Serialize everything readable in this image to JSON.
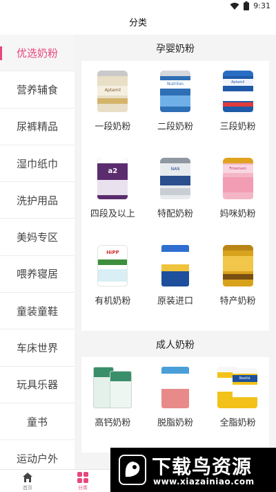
{
  "status_bar": {
    "time": "9:31"
  },
  "header": {
    "title": "分类"
  },
  "sidebar": {
    "items": [
      {
        "label": "优选奶粉",
        "active": true
      },
      {
        "label": "营养辅食"
      },
      {
        "label": "尿裤精品"
      },
      {
        "label": "湿巾纸巾"
      },
      {
        "label": "洗护用品"
      },
      {
        "label": "美妈专区"
      },
      {
        "label": "喂养寝居"
      },
      {
        "label": "童装童鞋"
      },
      {
        "label": "车床世界"
      },
      {
        "label": "玩具乐器"
      },
      {
        "label": "童书"
      },
      {
        "label": "运动户外"
      }
    ]
  },
  "sections": [
    {
      "title": "孕婴奶粉",
      "items": [
        {
          "label": "一段奶粉",
          "image_text": "Aptamil",
          "color": "#e7dcc0"
        },
        {
          "label": "二段奶粉",
          "image_text": "Nutrilon",
          "color": "#2f6fb5"
        },
        {
          "label": "三段奶粉",
          "image_text": "Aptamil",
          "color": "#1e5aa8"
        },
        {
          "label": "四段及以上",
          "image_text": "a2",
          "color": "#5b2d6e"
        },
        {
          "label": "特配奶粉",
          "image_text": "NAN",
          "color": "#a9b2bc"
        },
        {
          "label": "妈咪奶粉",
          "image_text": "Frisomum",
          "color": "#f2a3b8"
        },
        {
          "label": "有机奶粉",
          "image_text": "HiPP",
          "color": "#ffffff"
        },
        {
          "label": "原装进口",
          "image_text": "",
          "color": "#1d4f9c"
        },
        {
          "label": "特产奶粉",
          "image_text": "",
          "color": "#d9a21d"
        }
      ]
    },
    {
      "title": "成人奶粉",
      "items": [
        {
          "label": "高钙奶粉",
          "image_text": "",
          "color": "#dfeee8"
        },
        {
          "label": "脱脂奶粉",
          "image_text": "",
          "color": "#e98a8a"
        },
        {
          "label": "全脂奶粉",
          "image_text": "Nestlé",
          "color": "#f2c21a"
        }
      ]
    }
  ],
  "tabbar": {
    "tabs": [
      {
        "label": "首页"
      },
      {
        "label": "分类",
        "active": true
      }
    ]
  },
  "watermark": {
    "main": "下载鸟资源",
    "url": "www.xiazainiao.com"
  },
  "colors": {
    "accent": "#e8467c"
  }
}
